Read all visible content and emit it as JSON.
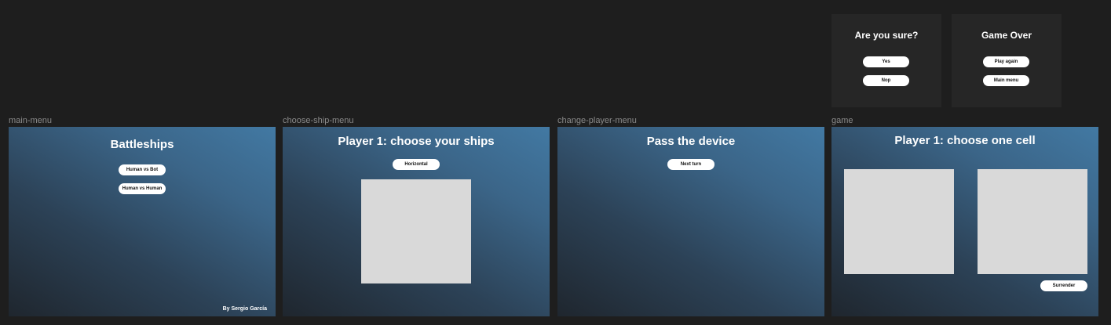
{
  "popups": {
    "confirm": {
      "title": "Are you sure?",
      "yes_label": "Yes",
      "no_label": "Nop"
    },
    "game_over": {
      "title": "Game Over",
      "play_again_label": "Play again",
      "main_menu_label": "Main menu"
    }
  },
  "frames": {
    "main_menu": {
      "label": "main-menu",
      "title": "Battleships",
      "human_vs_bot_label": "Human vs Bot",
      "human_vs_human_label": "Human vs Human",
      "credit": "By Sergio García"
    },
    "choose_ship_menu": {
      "label": "choose-ship-menu",
      "title": "Player 1: choose your ships",
      "orientation_label": "Horizontal"
    },
    "change_player_menu": {
      "label": "change-player-menu",
      "title": "Pass the device",
      "next_turn_label": "Next turn"
    },
    "game": {
      "label": "game",
      "title": "Player 1: choose one cell",
      "surrender_label": "Surrender"
    }
  },
  "colors": {
    "canvas_bg": "#1e1e1e",
    "popup_bg": "#262626",
    "gradient_dark": "#1f262e",
    "gradient_light": "#4279a3",
    "board": "#d9d9d9",
    "button_bg": "#ffffff"
  }
}
